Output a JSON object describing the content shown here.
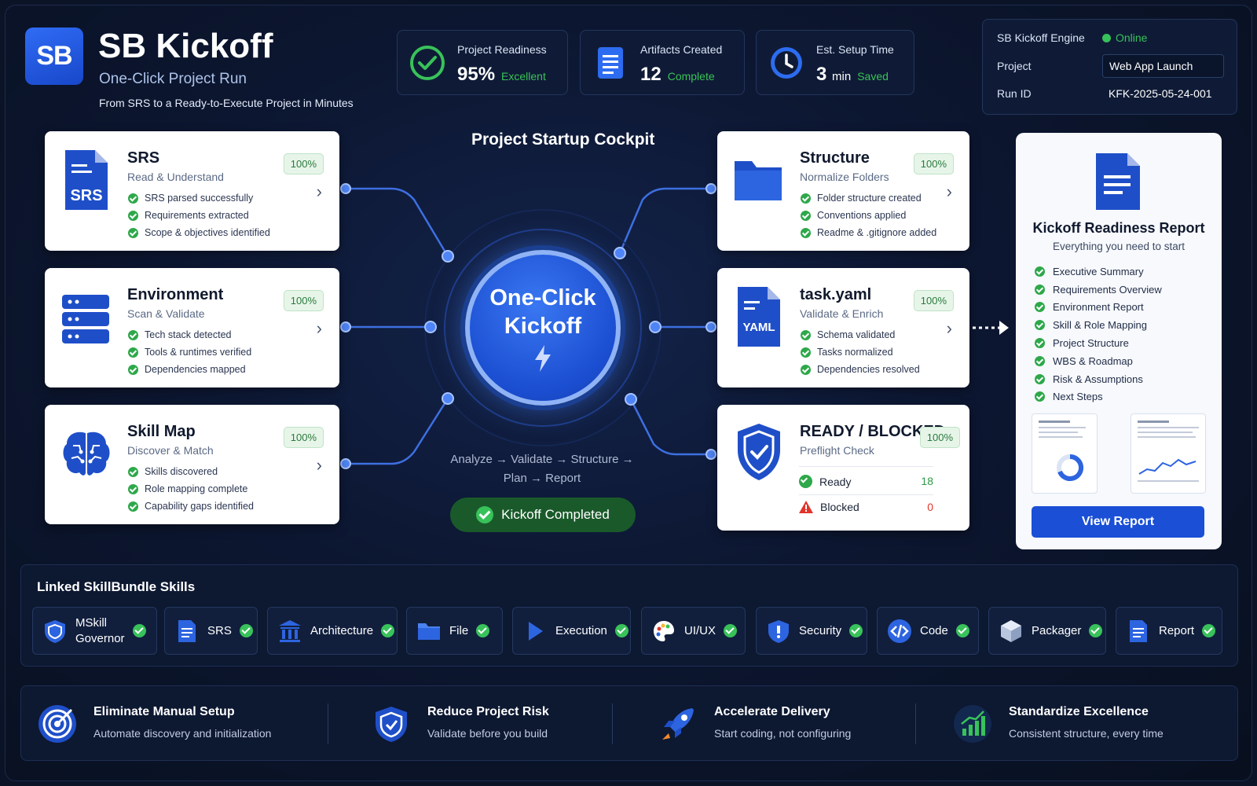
{
  "header": {
    "logo_text": "SB",
    "title": "SB Kickoff",
    "subtitle": "One-Click Project Run",
    "tagline": "From SRS to a Ready-to-Execute Project in Minutes"
  },
  "stats": [
    {
      "label": "Project Readiness",
      "value": "95%",
      "unit": "",
      "status": "Excellent",
      "icon": "check-circle-icon"
    },
    {
      "label": "Artifacts Created",
      "value": "12",
      "unit": "",
      "status": "Complete",
      "icon": "document-icon"
    },
    {
      "label": "Est. Setup Time",
      "value": "3",
      "unit": "min",
      "status": "Saved",
      "icon": "clock-icon"
    }
  ],
  "engine": {
    "label": "SB Kickoff Engine",
    "status": "Online",
    "project_label": "Project",
    "project_value": "Web App Launch",
    "run_label": "Run ID",
    "run_value": "KFK-2025-05-24-001"
  },
  "cockpit": {
    "title": "Project Startup Cockpit",
    "button_line1": "One-Click",
    "button_line2": "Kickoff",
    "flow_line1": "Analyze → Validate → Structure →",
    "flow_line2": "Plan → Report",
    "completed": "Kickoff Completed"
  },
  "steps": {
    "srs": {
      "title": "SRS",
      "subtitle": "Read & Understand",
      "pct": "100%",
      "icon_text": "SRS",
      "items": [
        "SRS parsed successfully",
        "Requirements extracted",
        "Scope & objectives identified"
      ]
    },
    "environment": {
      "title": "Environment",
      "subtitle": "Scan & Validate",
      "pct": "100%",
      "items": [
        "Tech stack detected",
        "Tools & runtimes verified",
        "Dependencies mapped"
      ]
    },
    "skillmap": {
      "title": "Skill Map",
      "subtitle": "Discover & Match",
      "pct": "100%",
      "items": [
        "Skills discovered",
        "Role mapping complete",
        "Capability gaps identified"
      ]
    },
    "structure": {
      "title": "Structure",
      "subtitle": "Normalize Folders",
      "pct": "100%",
      "items": [
        "Folder structure created",
        "Conventions applied",
        "Readme & .gitignore added"
      ]
    },
    "taskyaml": {
      "title": "task.yaml",
      "subtitle": "Validate & Enrich",
      "pct": "100%",
      "icon_text": "YAML",
      "items": [
        "Schema validated",
        "Tasks normalized",
        "Dependencies resolved"
      ]
    },
    "preflight": {
      "title": "READY / BLOCKED",
      "subtitle": "Preflight Check",
      "pct": "100%",
      "ready_label": "Ready",
      "ready_count": "18",
      "blocked_label": "Blocked",
      "blocked_count": "0"
    }
  },
  "report": {
    "title": "Kickoff Readiness Report",
    "subtitle": "Everything you need to start",
    "items": [
      "Executive Summary",
      "Requirements Overview",
      "Environment Report",
      "Skill & Role Mapping",
      "Project Structure",
      "WBS & Roadmap",
      "Risk & Assumptions",
      "Next Steps"
    ],
    "button": "View Report"
  },
  "skills": {
    "title": "Linked SkillBundle Skills",
    "chips": [
      {
        "label1": "MSkill",
        "label2": "Governor",
        "icon": "shield-icon"
      },
      {
        "label1": "SRS",
        "label2": "",
        "icon": "document-icon"
      },
      {
        "label1": "Architecture",
        "label2": "",
        "icon": "building-icon"
      },
      {
        "label1": "File",
        "label2": "",
        "icon": "folder-icon"
      },
      {
        "label1": "Execution",
        "label2": "",
        "icon": "play-icon"
      },
      {
        "label1": "UI/UX",
        "label2": "",
        "icon": "palette-icon"
      },
      {
        "label1": "Security",
        "label2": "",
        "icon": "security-shield-icon"
      },
      {
        "label1": "Code",
        "label2": "",
        "icon": "code-icon"
      },
      {
        "label1": "Packager",
        "label2": "",
        "icon": "package-icon"
      },
      {
        "label1": "Report",
        "label2": "",
        "icon": "report-icon"
      }
    ]
  },
  "benefits": [
    {
      "title": "Eliminate Manual Setup",
      "desc": "Automate discovery and initialization",
      "icon": "target-icon"
    },
    {
      "title": "Reduce Project Risk",
      "desc": "Validate before you build",
      "icon": "shield-icon"
    },
    {
      "title": "Accelerate Delivery",
      "desc": "Start coding, not configuring",
      "icon": "rocket-icon"
    },
    {
      "title": "Standardize Excellence",
      "desc": "Consistent structure, every time",
      "icon": "growth-chart-icon"
    }
  ],
  "colors": {
    "accent": "#1a4fd6",
    "success": "#38c25a",
    "danger": "#e0352b",
    "background": "#0b1427"
  }
}
